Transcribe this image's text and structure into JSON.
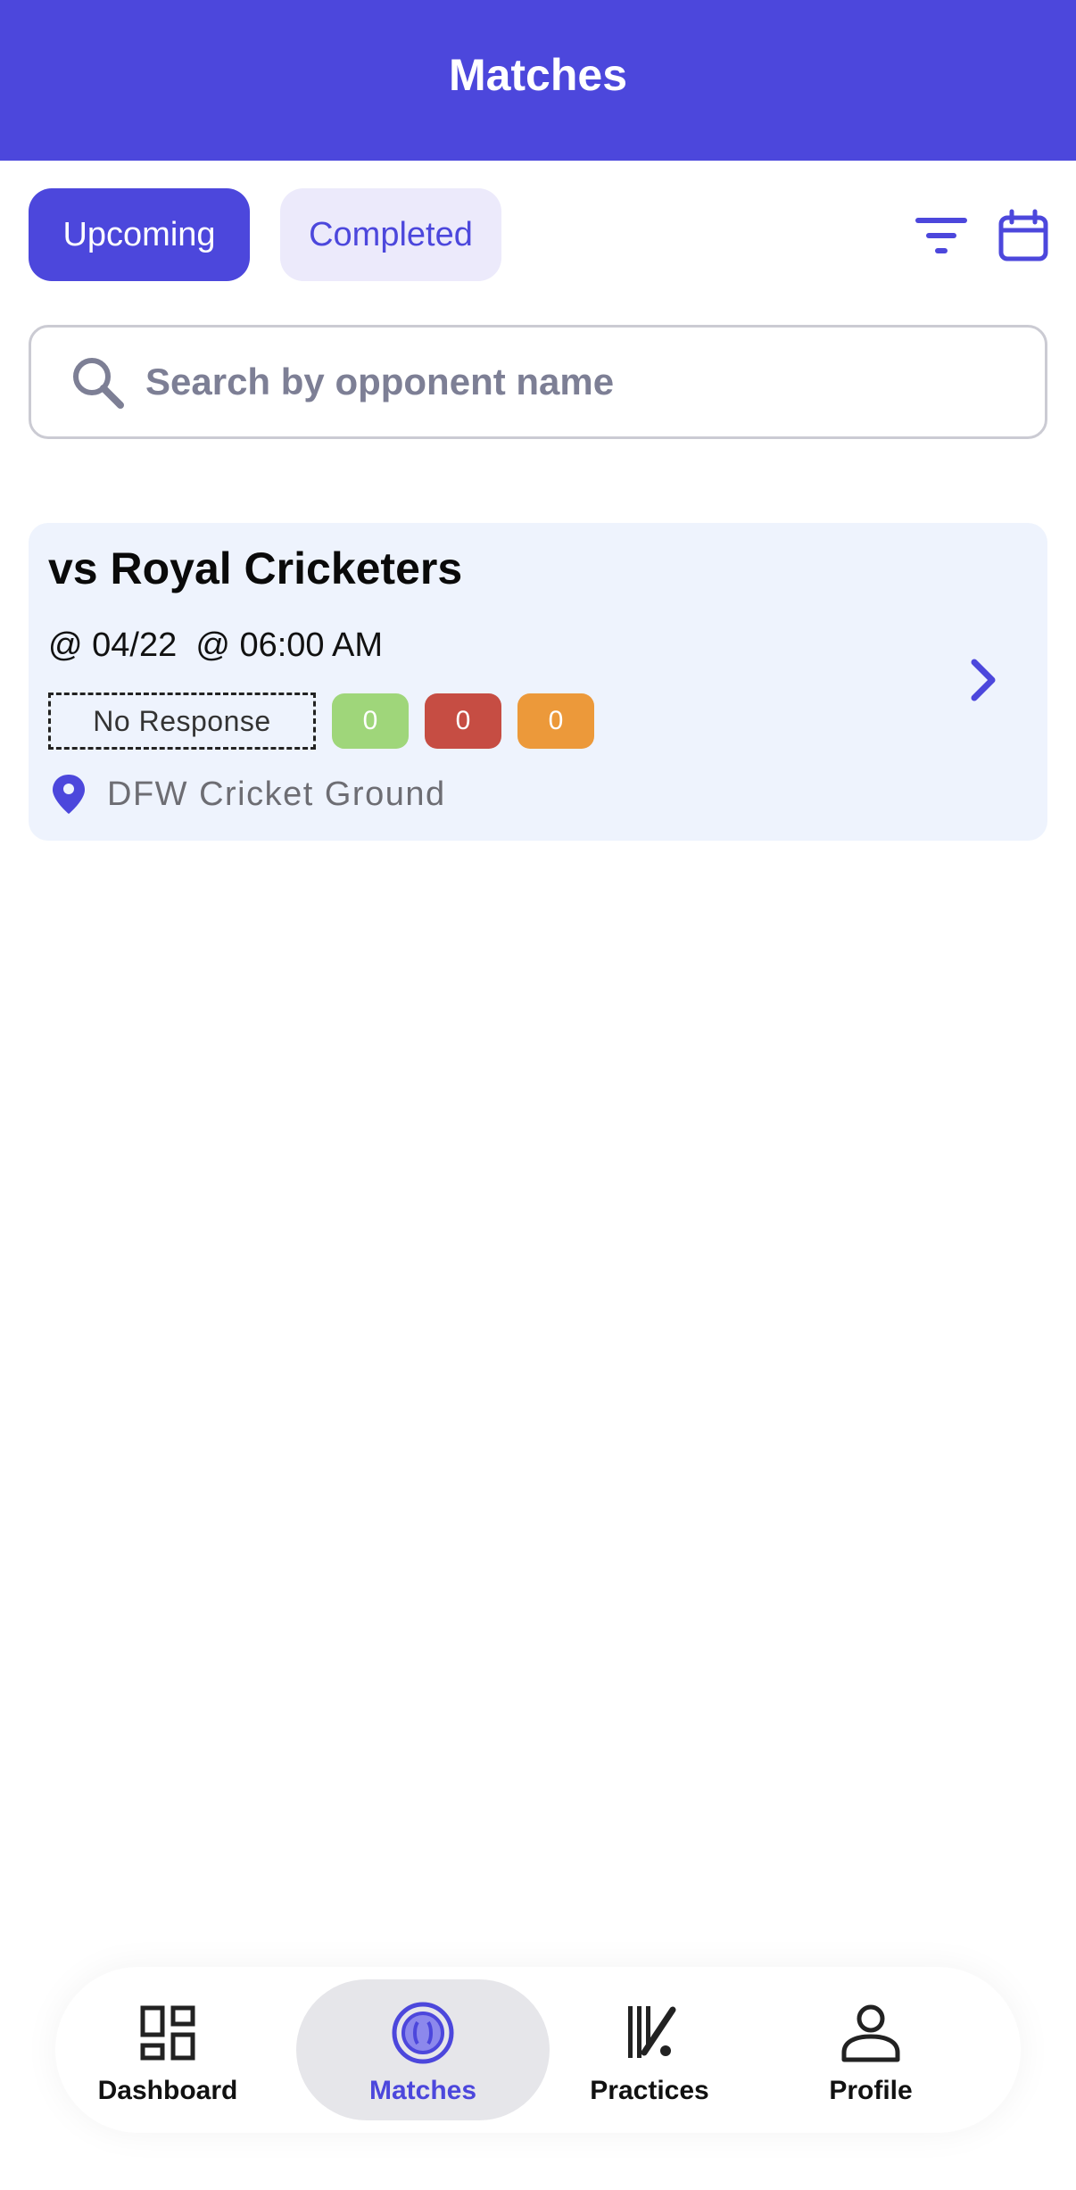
{
  "header": {
    "title": "Matches"
  },
  "segments": {
    "upcoming": "Upcoming",
    "completed": "Completed",
    "active": "upcoming"
  },
  "toolbar": {
    "filter_icon": "filter-icon",
    "calendar_icon": "calendar-icon"
  },
  "search": {
    "placeholder": "Search by opponent name",
    "value": ""
  },
  "matches": [
    {
      "title": "vs Royal Cricketers",
      "datetime": "@ 04/22  @ 06:00 AM",
      "response_status": "No Response",
      "counts": {
        "available": "0",
        "unavailable": "0",
        "maybe": "0"
      },
      "venue": "DFW Cricket Ground"
    }
  ],
  "bottom_nav": {
    "items": [
      {
        "label": "Dashboard",
        "icon": "dashboard-icon"
      },
      {
        "label": "Matches",
        "icon": "matches-icon"
      },
      {
        "label": "Practices",
        "icon": "practices-icon"
      },
      {
        "label": "Profile",
        "icon": "profile-icon"
      }
    ],
    "active": "Matches"
  },
  "colors": {
    "accent": "#4c47dc",
    "card_bg": "#eef3fd",
    "badge_green": "#9fd67a",
    "badge_red": "#c64d43",
    "badge_orange": "#ec993a"
  }
}
